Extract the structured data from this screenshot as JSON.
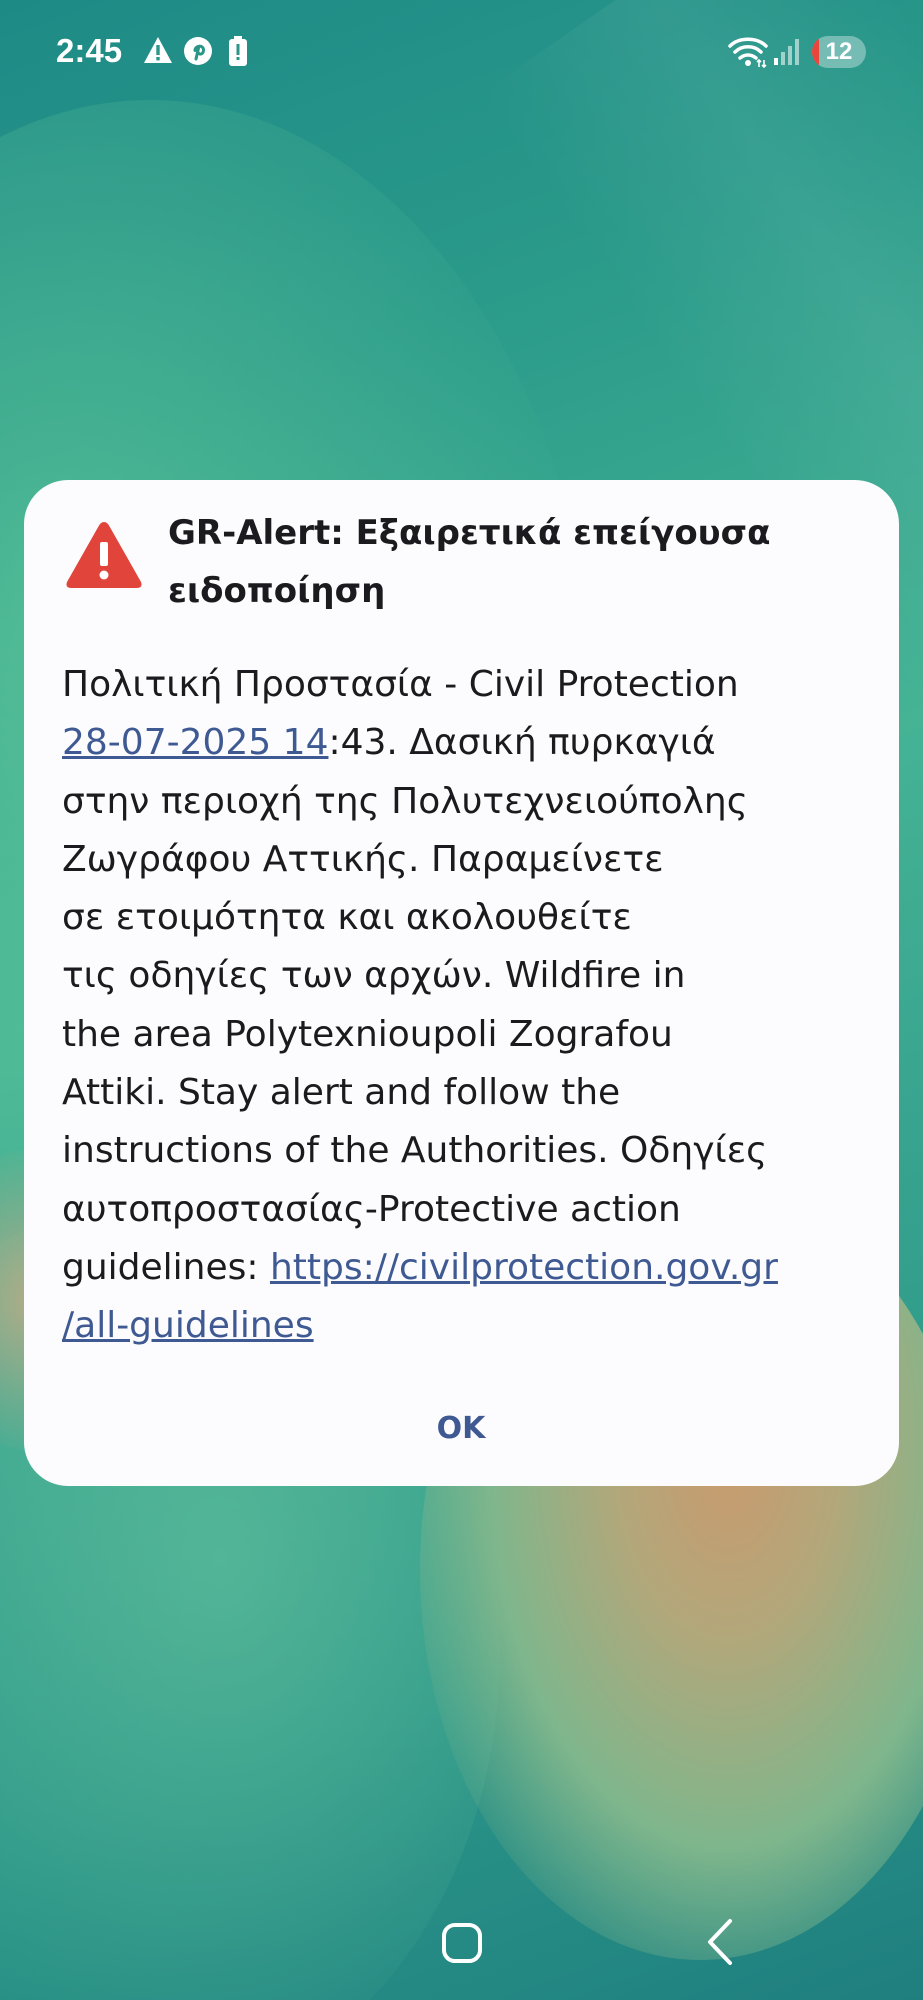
{
  "status_bar": {
    "time": "2:45",
    "icons": [
      "warning-icon",
      "pinterest-icon",
      "battery-alert-icon",
      "wifi-icon",
      "signal-icon"
    ],
    "battery_level": "12",
    "battery_color": "#e8463c"
  },
  "alert": {
    "icon": "warning-triangle-icon",
    "icon_color": "#e0443a",
    "title": "GR-Alert: Εξαιρετικά επείγουσα ειδοποίηση",
    "body_line1": "Πολιτική Προστασία - Civil Protection",
    "body_link_date": "28-07-2025 14",
    "body_after_date": ":43. Δασική πυρκαγιά\nστην περιοχή της Πολυτεχνειούπολης\nΖωγράφου Αττικής. Παραμείνετε\nσε ετοιμότητα και ακολουθείτε\nτις οδηγίες των αρχών. Wildfire in\nthe area Polytexnioupoli Zografou\nAttiki. Stay alert and follow the\ninstructions of the Authorities. Οδηγίες\nαυτοπροστασίας-Protective action\nguidelines: ",
    "body_link_url": "https://civilprotection.gov.gr\n/all-guidelines",
    "link_color": "#3f5a93",
    "ok_label": "OK"
  },
  "nav_bar": {
    "home_icon": "home-icon",
    "back_icon": "back-icon"
  }
}
